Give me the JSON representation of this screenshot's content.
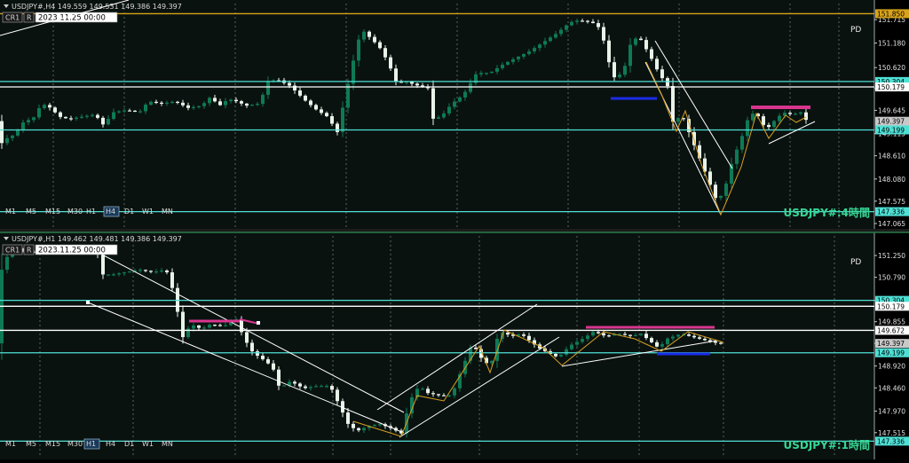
{
  "colors": {
    "bg": "#0a1210",
    "grid": "#6a7a72",
    "up": "#0e7a55",
    "down": "#e9f3e9",
    "aqua": "#4fe0d5",
    "white": "#ffffff",
    "gold": "#d8a31a",
    "magenta": "#d8358e",
    "blue": "#1a2de8",
    "zigzag": "#d8a020",
    "title": "#36d695"
  },
  "common": {
    "indicator_label": "PD",
    "buttons": [
      "CR1",
      "R"
    ],
    "date_label": "2023.11.25 00:00"
  },
  "panes": [
    {
      "header": "USDJPY#,H4 149.559 149.531 149.386 149.397",
      "title": "USDJPY#:4時間",
      "timeframes": [
        "M1",
        "M5",
        "M15",
        "M30",
        "H1",
        "H4",
        "D1",
        "W1",
        "MN"
      ],
      "active_timeframe": "H4",
      "y_axis": {
        "min": 147.065,
        "max": 152.0,
        "ticks": [
          "151.715",
          "151.180",
          "150.620",
          "150.145",
          "149.645",
          "149.115",
          "148.610",
          "148.080",
          "147.575",
          "147.065"
        ],
        "price_tags": [
          {
            "value": "151.850",
            "color": "gold"
          },
          {
            "value": "150.304",
            "color": "aqua"
          },
          {
            "value": "150.179",
            "color": "white"
          },
          {
            "value": "149.397",
            "color": "grey"
          },
          {
            "value": "149.199",
            "color": "aqua"
          },
          {
            "value": "147.336",
            "color": "aqua"
          }
        ]
      }
    },
    {
      "header": "USDJPY#,H1 149.462 149.481 149.386 149.397",
      "title": "USDJPY#:1時間",
      "timeframes": [
        "M1",
        "M5",
        "M15",
        "M30",
        "H1",
        "H4",
        "D1",
        "W1",
        "MN"
      ],
      "active_timeframe": "H1",
      "y_axis": {
        "min": 147.1,
        "max": 151.55,
        "ticks": [
          "151.250",
          "150.790",
          "150.304",
          "149.855",
          "149.397",
          "148.920",
          "148.460",
          "147.970",
          "147.515"
        ],
        "price_tags": [
          {
            "value": "150.304",
            "color": "aqua"
          },
          {
            "value": "150.179",
            "color": "white"
          },
          {
            "value": "149.672",
            "color": "white"
          },
          {
            "value": "149.397",
            "color": "grey"
          },
          {
            "value": "149.199",
            "color": "aqua"
          },
          {
            "value": "147.336",
            "color": "aqua"
          }
        ]
      }
    }
  ],
  "chart_data": [
    {
      "type": "candlestick",
      "symbol": "USDJPY#",
      "timeframe": "H4",
      "last_bar": {
        "open": 149.559,
        "high": 149.531,
        "low": 149.386,
        "close": 149.397
      },
      "horizontal_levels": [
        151.85,
        150.304,
        150.179,
        149.199,
        147.336
      ],
      "path": [
        [
          0,
          148.8
        ],
        [
          10,
          149.0
        ],
        [
          20,
          149.1
        ],
        [
          30,
          149.4
        ],
        [
          40,
          149.45
        ],
        [
          50,
          149.8
        ],
        [
          60,
          149.7
        ],
        [
          70,
          149.5
        ],
        [
          80,
          149.45
        ],
        [
          95,
          149.5
        ],
        [
          110,
          149.55
        ],
        [
          120,
          149.3
        ],
        [
          130,
          149.6
        ],
        [
          145,
          149.65
        ],
        [
          160,
          149.6
        ],
        [
          170,
          149.85
        ],
        [
          185,
          149.8
        ],
        [
          200,
          149.85
        ],
        [
          215,
          149.7
        ],
        [
          230,
          149.75
        ],
        [
          240,
          149.95
        ],
        [
          250,
          149.75
        ],
        [
          260,
          149.9
        ],
        [
          270,
          149.85
        ],
        [
          280,
          149.75
        ],
        [
          295,
          149.8
        ],
        [
          305,
          150.3
        ],
        [
          315,
          150.35
        ],
        [
          330,
          150.2
        ],
        [
          345,
          149.9
        ],
        [
          360,
          149.65
        ],
        [
          372,
          149.5
        ],
        [
          383,
          149.15
        ],
        [
          390,
          149.8
        ],
        [
          400,
          150.7
        ],
        [
          410,
          151.5
        ],
        [
          420,
          151.3
        ],
        [
          430,
          151.1
        ],
        [
          440,
          150.75
        ],
        [
          450,
          150.25
        ],
        [
          460,
          150.3
        ],
        [
          475,
          150.2
        ],
        [
          485,
          150.15
        ],
        [
          490,
          149.45
        ],
        [
          500,
          149.5
        ],
        [
          512,
          149.8
        ],
        [
          525,
          150.0
        ],
        [
          540,
          150.5
        ],
        [
          555,
          150.5
        ],
        [
          570,
          150.7
        ],
        [
          585,
          150.85
        ],
        [
          600,
          151.0
        ],
        [
          615,
          151.2
        ],
        [
          630,
          151.4
        ],
        [
          645,
          151.65
        ],
        [
          655,
          151.7
        ],
        [
          670,
          151.65
        ],
        [
          680,
          151.5
        ],
        [
          688,
          150.8
        ],
        [
          695,
          150.4
        ],
        [
          705,
          150.5
        ],
        [
          715,
          151.3
        ],
        [
          725,
          151.25
        ],
        [
          735,
          150.9
        ],
        [
          745,
          150.5
        ],
        [
          755,
          150.2
        ],
        [
          762,
          149.25
        ],
        [
          770,
          149.6
        ],
        [
          780,
          149.1
        ],
        [
          790,
          148.6
        ],
        [
          800,
          148.1
        ],
        [
          810,
          147.6
        ],
        [
          818,
          147.75
        ],
        [
          828,
          148.5
        ],
        [
          838,
          149.0
        ],
        [
          848,
          149.6
        ],
        [
          858,
          149.5
        ],
        [
          866,
          149.2
        ],
        [
          875,
          149.4
        ],
        [
          885,
          149.6
        ],
        [
          895,
          149.55
        ],
        [
          905,
          149.6
        ],
        [
          912,
          149.4
        ]
      ]
    },
    {
      "type": "candlestick",
      "symbol": "USDJPY#",
      "timeframe": "H1",
      "last_bar": {
        "open": 149.462,
        "high": 149.481,
        "low": 149.386,
        "close": 149.397
      },
      "horizontal_levels": [
        150.304,
        150.179,
        149.672,
        149.199,
        147.336
      ],
      "path": [
        [
          0,
          150.7
        ],
        [
          10,
          151.2
        ],
        [
          20,
          151.4
        ],
        [
          30,
          151.35
        ],
        [
          45,
          151.3
        ],
        [
          60,
          151.35
        ],
        [
          80,
          151.3
        ],
        [
          100,
          151.4
        ],
        [
          112,
          151.35
        ],
        [
          118,
          150.85
        ],
        [
          130,
          150.85
        ],
        [
          145,
          150.9
        ],
        [
          160,
          150.95
        ],
        [
          175,
          150.9
        ],
        [
          190,
          150.95
        ],
        [
          200,
          150.4
        ],
        [
          208,
          149.5
        ],
        [
          218,
          149.8
        ],
        [
          230,
          149.7
        ],
        [
          240,
          149.8
        ],
        [
          255,
          149.75
        ],
        [
          268,
          149.95
        ],
        [
          278,
          149.5
        ],
        [
          288,
          149.2
        ],
        [
          300,
          149.05
        ],
        [
          310,
          148.9
        ],
        [
          318,
          148.45
        ],
        [
          330,
          148.6
        ],
        [
          345,
          148.45
        ],
        [
          360,
          148.5
        ],
        [
          375,
          148.5
        ],
        [
          385,
          148.1
        ],
        [
          395,
          147.7
        ],
        [
          405,
          147.55
        ],
        [
          418,
          147.65
        ],
        [
          430,
          147.7
        ],
        [
          445,
          147.6
        ],
        [
          455,
          147.5
        ],
        [
          465,
          148.2
        ],
        [
          475,
          148.5
        ],
        [
          485,
          148.35
        ],
        [
          498,
          148.3
        ],
        [
          512,
          148.3
        ],
        [
          522,
          148.8
        ],
        [
          535,
          149.4
        ],
        [
          548,
          149.0
        ],
        [
          556,
          148.95
        ],
        [
          565,
          149.65
        ],
        [
          580,
          149.55
        ],
        [
          590,
          149.6
        ],
        [
          600,
          149.45
        ],
        [
          610,
          149.3
        ],
        [
          620,
          149.2
        ],
        [
          632,
          149.1
        ],
        [
          645,
          149.35
        ],
        [
          660,
          149.5
        ],
        [
          672,
          149.65
        ],
        [
          685,
          149.55
        ],
        [
          700,
          149.6
        ],
        [
          715,
          149.55
        ],
        [
          725,
          149.6
        ],
        [
          735,
          149.45
        ],
        [
          745,
          149.3
        ],
        [
          755,
          149.5
        ],
        [
          770,
          149.6
        ],
        [
          780,
          149.55
        ],
        [
          790,
          149.5
        ],
        [
          800,
          149.45
        ],
        [
          812,
          149.397
        ]
      ]
    }
  ]
}
